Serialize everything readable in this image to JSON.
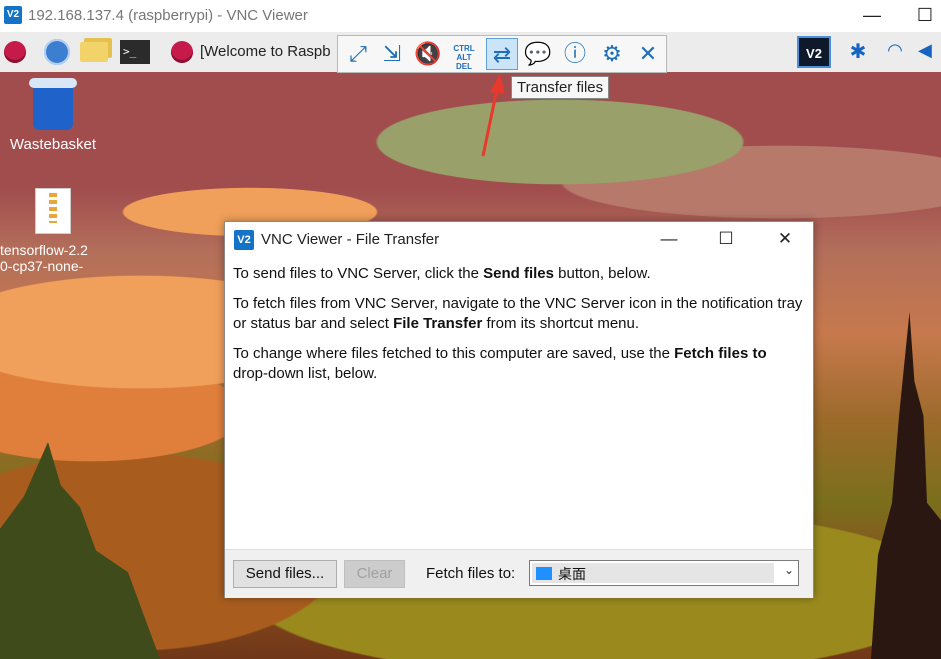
{
  "vnc_window": {
    "logo": "V2",
    "title": "192.168.137.4 (raspberrypi) - VNC Viewer",
    "minimize": "—",
    "maximize": "☐"
  },
  "panel": {
    "task_label": "[Welcome to Raspb",
    "terminal_glyph": ">_",
    "tray": {
      "vnc_logo": "V2",
      "bluetooth_glyph": "✱",
      "wifi_glyph": "◠",
      "audio_glyph": "◀"
    }
  },
  "toolbar": {
    "buttons": [
      {
        "name": "full-screen",
        "glyph": "⤢"
      },
      {
        "name": "scale",
        "glyph": "⇲"
      },
      {
        "name": "mute",
        "glyph": "🔇"
      },
      {
        "name": "ctrl-alt-del",
        "glyph": "CTRL ALT DEL"
      },
      {
        "name": "transfer-files",
        "glyph": "⇄"
      },
      {
        "name": "chat",
        "glyph": "💬"
      },
      {
        "name": "info",
        "glyph": "ⓘ"
      },
      {
        "name": "settings",
        "glyph": "⚙"
      },
      {
        "name": "close",
        "glyph": "✕"
      }
    ],
    "tooltip": "Transfer files"
  },
  "desktop": {
    "icons": [
      {
        "label": "Wastebasket"
      },
      {
        "label_line1": "tensorflow-2.2",
        "label_line2": "0-cp37-none-"
      }
    ]
  },
  "dialog": {
    "logo": "V2",
    "title": "VNC Viewer - File Transfer",
    "minimize": "—",
    "maximize": "☐",
    "close": "✕",
    "p1_pre": "To send files to VNC Server, click the ",
    "p1_bold": "Send files",
    "p1_post": " button, below.",
    "p2_pre": "To fetch files from VNC Server, navigate to the VNC Server icon in the notification tray or status bar and select ",
    "p2_bold": "File Transfer",
    "p2_post": " from its shortcut menu.",
    "p3_pre": "To change where files fetched to this computer are saved, use the ",
    "p3_bold": "Fetch files to",
    "p3_post": " drop-down list, below.",
    "send_button": "Send files...",
    "clear_button": "Clear",
    "fetch_label": "Fetch files to:",
    "fetch_value": "桌面",
    "dropdown_glyph": "⌄"
  },
  "colors": {
    "accent": "#1e6fb8",
    "annotation_arrow": "#e8392c",
    "active_button_bg": "#cce4f7"
  }
}
